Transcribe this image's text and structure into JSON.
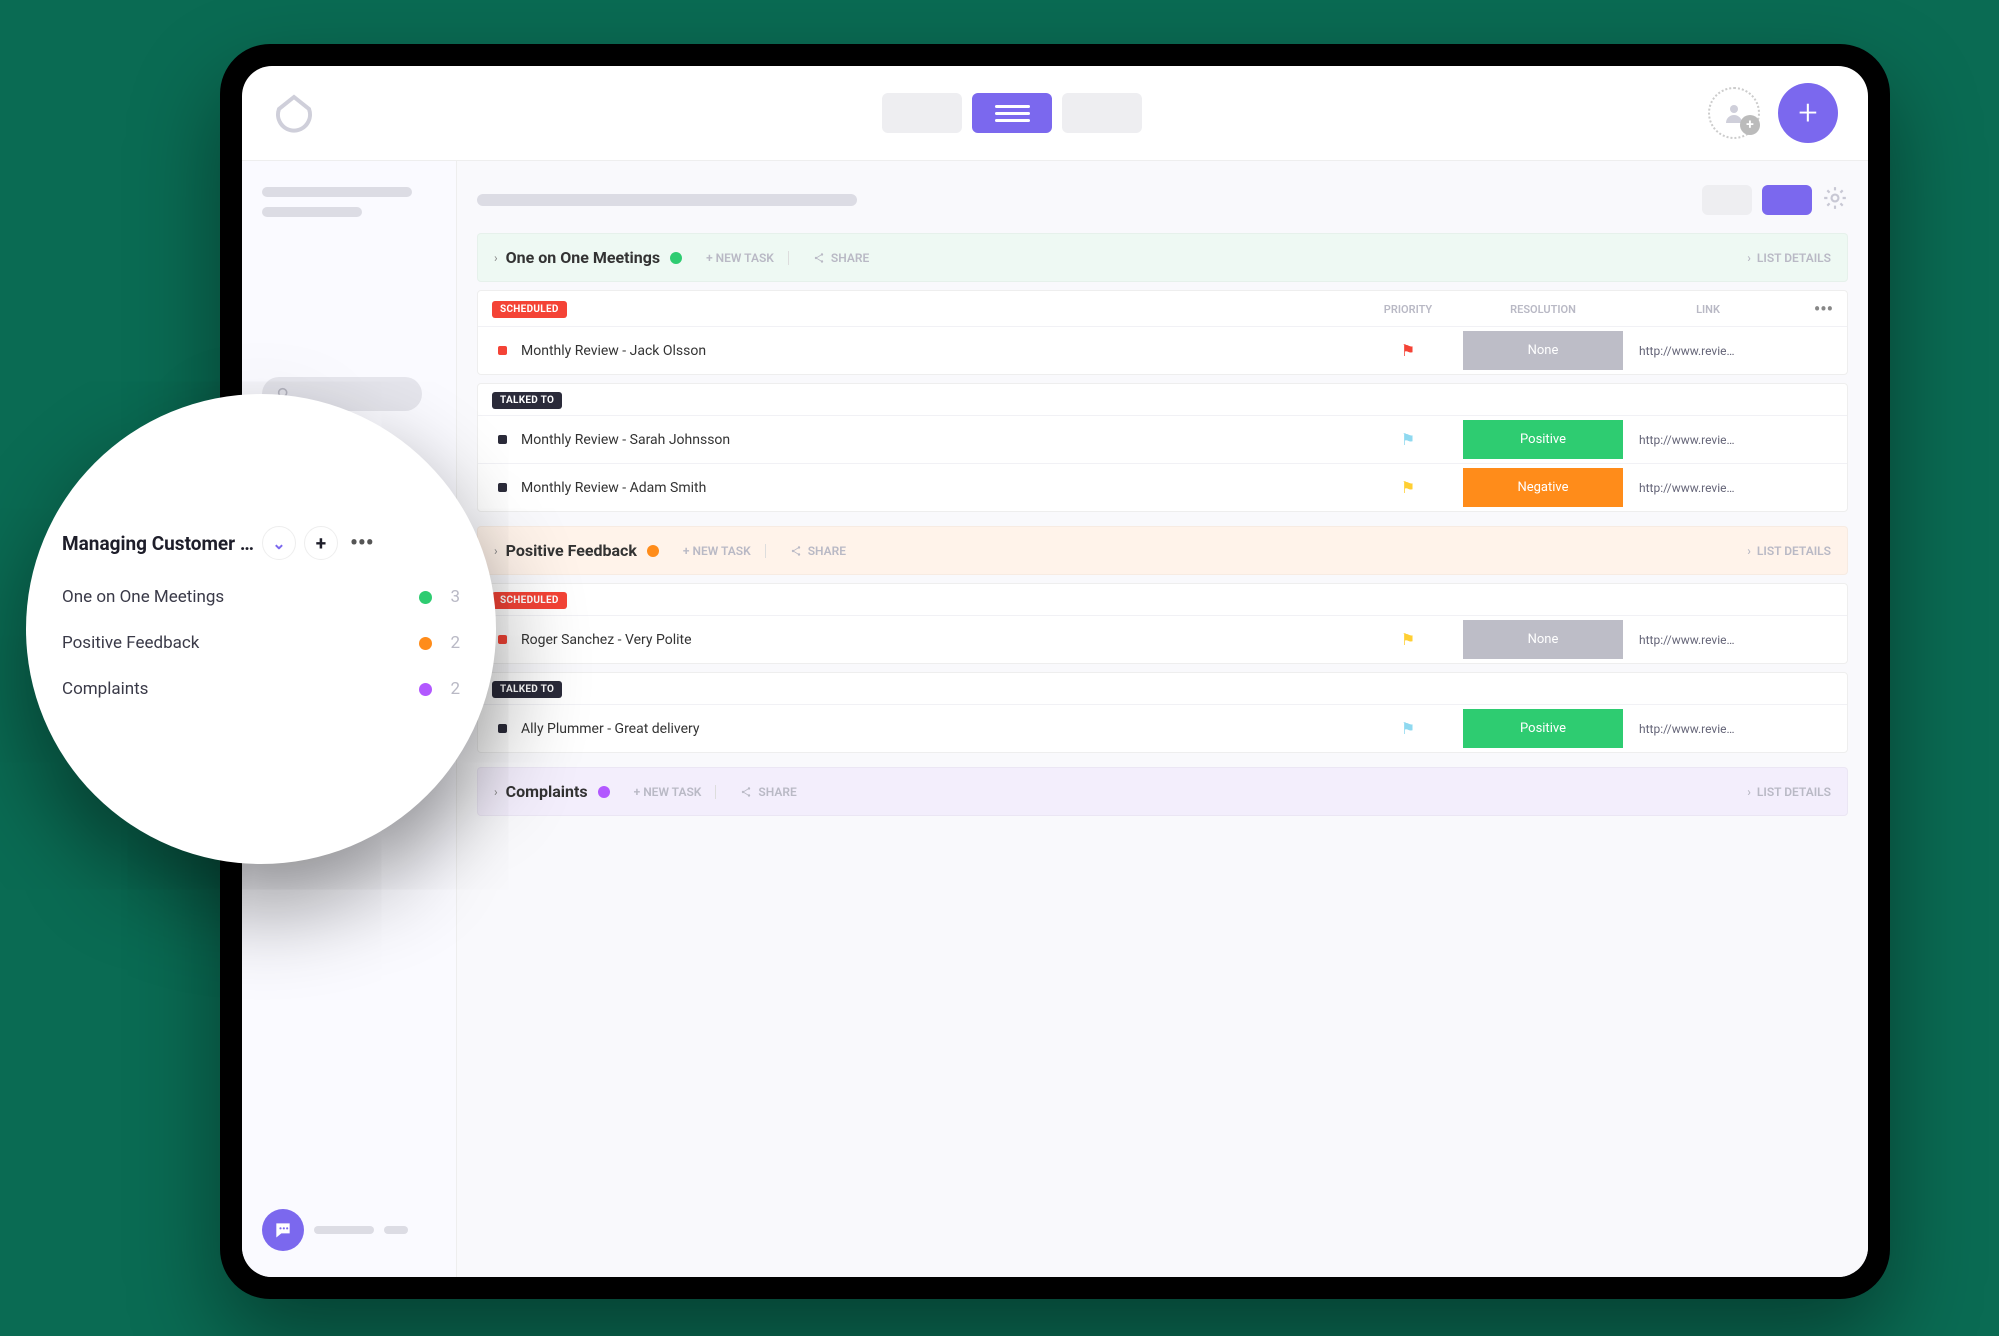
{
  "colors": {
    "accent": "#7b68ee",
    "green": "#2ecc71",
    "orange": "#ff8c1a",
    "purple": "#b258ff",
    "red": "#f44336"
  },
  "topbar": {
    "active_view": "list"
  },
  "sidebar_popover": {
    "title": "Managing Customer …",
    "items": [
      {
        "label": "One on One Meetings",
        "color": "green",
        "count": 3
      },
      {
        "label": "Positive Feedback",
        "color": "orange",
        "count": 2
      },
      {
        "label": "Complaints",
        "color": "purple",
        "count": 2
      }
    ]
  },
  "labels": {
    "new_task": "+ NEW TASK",
    "share": "SHARE",
    "list_details": "LIST DETAILS",
    "priority": "PRIORITY",
    "resolution": "RESOLUTION",
    "link": "LINK"
  },
  "statuses": {
    "scheduled": "SCHEDULED",
    "talked_to": "TALKED TO"
  },
  "resolutions": {
    "none": "None",
    "positive": "Positive",
    "negative": "Negative"
  },
  "link_text": "http://www.revie…",
  "lists": [
    {
      "name": "One on One Meetings",
      "dot": "green",
      "sections": [
        {
          "status": "scheduled",
          "show_cols": true,
          "tasks": [
            {
              "title": "Monthly Review - Jack Olsson",
              "sq": "red",
              "flag": "red",
              "resolution": "none"
            }
          ]
        },
        {
          "status": "talked_to",
          "show_cols": false,
          "tasks": [
            {
              "title": "Monthly Review - Sarah Johnsson",
              "sq": "dark",
              "flag": "cyan",
              "resolution": "positive"
            },
            {
              "title": "Monthly Review - Adam Smith",
              "sq": "dark",
              "flag": "yellow",
              "resolution": "negative"
            }
          ]
        }
      ]
    },
    {
      "name": "Positive Feedback",
      "dot": "orange",
      "sections": [
        {
          "status": "scheduled",
          "show_cols": false,
          "tasks": [
            {
              "title": "Roger Sanchez - Very Polite",
              "sq": "red",
              "flag": "yellow",
              "resolution": "none"
            }
          ]
        },
        {
          "status": "talked_to",
          "show_cols": false,
          "tasks": [
            {
              "title": "Ally Plummer - Great delivery",
              "sq": "dark",
              "flag": "cyan",
              "resolution": "positive"
            }
          ]
        }
      ]
    },
    {
      "name": "Complaints",
      "dot": "purple",
      "sections": []
    }
  ]
}
